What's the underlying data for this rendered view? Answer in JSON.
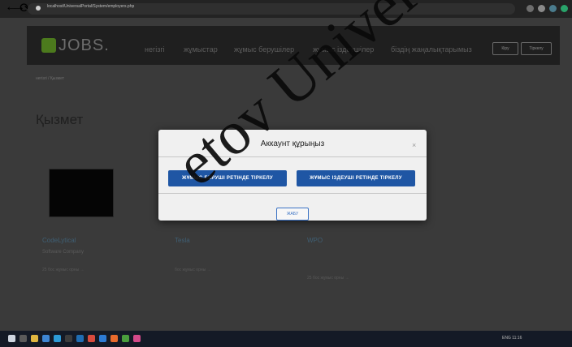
{
  "browser": {
    "url": "localhost/UniversalPortal/System/employers.php",
    "nav_glyphs": [
      "←",
      "→",
      "⟳"
    ]
  },
  "navbar": {
    "logo_text": "JOBS.",
    "menu": [
      "негізгі",
      "жұмыстар",
      "жұмыс берушілер",
      "жұмыс іздеушілер",
      "біздің жаңалықтарымыз"
    ],
    "buttons": [
      "Кіру",
      "Тіркелу"
    ]
  },
  "breadcrumb": "негізгі / Қызмет",
  "heading": "Қызмет",
  "cards": [
    {
      "title": "CodeLytical",
      "subtitle": "Software Company",
      "link": "25 бос жұмыс орны →"
    },
    {
      "title": "Tesla",
      "subtitle": "",
      "link": "бос жұмыс орны →"
    },
    {
      "title": "WPO",
      "subtitle": "",
      "link": "25 бос жұмыс орны →"
    }
  ],
  "modal": {
    "title": "Аккаунт құрыңыз",
    "close": "×",
    "employer_button": "ЖҰМЫС БЕРУШІ РЕТІНДЕ ТІРКЕЛУ",
    "seeker_button": "ЖҰМЫС ІЗДЕУШІ РЕТІНДЕ ТІРКЕЛУ",
    "cancel_button": "ЖАБУ"
  },
  "taskbar": {
    "tray": "ENG 11:16"
  },
  "watermark": "etov Univer",
  "colors": {
    "modal_button": "#1f56a4",
    "logo_green": "#4c7a1d"
  }
}
